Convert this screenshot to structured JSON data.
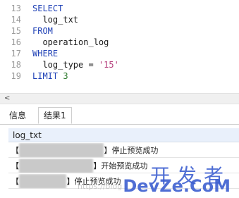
{
  "editor": {
    "lines": [
      {
        "num": "13",
        "text": "SELECT"
      },
      {
        "num": "14",
        "text": "  log_txt"
      },
      {
        "num": "15",
        "text": "FROM"
      },
      {
        "num": "16",
        "text": "  operation_log"
      },
      {
        "num": "17",
        "text": "WHERE"
      },
      {
        "num": "18",
        "text": "  log_type = '15'"
      },
      {
        "num": "19",
        "text": "LIMIT 3"
      }
    ]
  },
  "hscroll": {
    "left_arrow": "<"
  },
  "tabs": [
    {
      "label": "信息"
    },
    {
      "label": "结果1"
    }
  ],
  "grid": {
    "column_header": "log_txt",
    "rows": [
      {
        "prefix": "【",
        "blurred": "C6_0134K679枚台三通",
        "suffix": "】停止预览成功"
      },
      {
        "prefix": "【",
        "blurred": "SS_Y2K500指台三通",
        "suffix": "】开始预览成功"
      },
      {
        "prefix": "【",
        "blurred": "S___________",
        "suffix": "】停止预览成功"
      }
    ]
  },
  "watermark": {
    "cn": "开发者",
    "en": "DevZe.CoM",
    "url": "https://blog"
  }
}
